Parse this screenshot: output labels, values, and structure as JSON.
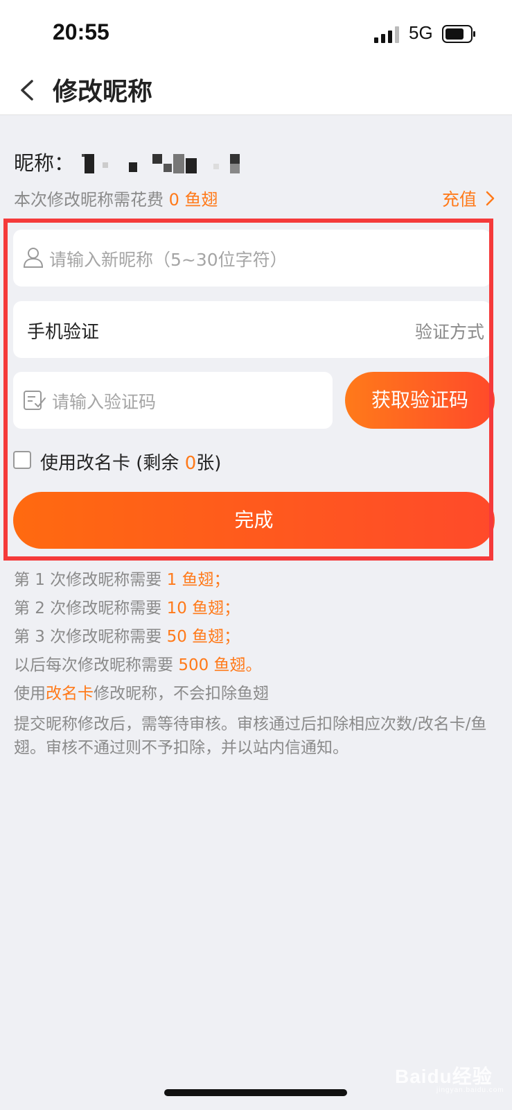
{
  "status": {
    "time": "20:55",
    "network": "5G"
  },
  "nav": {
    "title": "修改昵称"
  },
  "nickname": {
    "label": "昵称："
  },
  "fee": {
    "prefix": "本次修改昵称需花费 ",
    "amount": "0 鱼翅"
  },
  "recharge": {
    "label": "充值"
  },
  "form": {
    "new_nickname_placeholder": "请输入新昵称（5~30位字符）",
    "phone_verify_label": "手机验证",
    "verify_method_label": "验证方式",
    "code_placeholder": "请输入验证码",
    "get_code_button": "获取验证码",
    "rename_card_prefix": "使用改名卡 (剩余 ",
    "rename_card_count": "0",
    "rename_card_suffix": "张)",
    "rename_card_checked": false,
    "done_button": "完成"
  },
  "rules": [
    {
      "prefix": "第 1 次修改昵称需要 ",
      "highlight": "1 鱼翅",
      "suffix": "；"
    },
    {
      "prefix": "第 2 次修改昵称需要 ",
      "highlight": "10 鱼翅",
      "suffix": "；"
    },
    {
      "prefix": "第 3 次修改昵称需要 ",
      "highlight": "50 鱼翅",
      "suffix": "；"
    },
    {
      "prefix": "以后每次修改昵称需要 ",
      "highlight": "500 鱼翅",
      "suffix": "。"
    },
    {
      "prefix": "使用",
      "highlight": "改名卡",
      "suffix": "修改昵称，不会扣除鱼翅"
    },
    {
      "prefix": "提交昵称修改后，需等待审核。审核通过后扣除相应次数/改名卡/鱼翅。审核不通过则不予扣除，并以站内信通知。",
      "highlight": "",
      "suffix": ""
    }
  ],
  "watermark": {
    "text": "Baidu经验",
    "url": "jingyan.baidu.com"
  },
  "colors": {
    "accent": "#ff7a1a",
    "highlight_box": "#f53a3a",
    "background": "#eff0f4"
  }
}
